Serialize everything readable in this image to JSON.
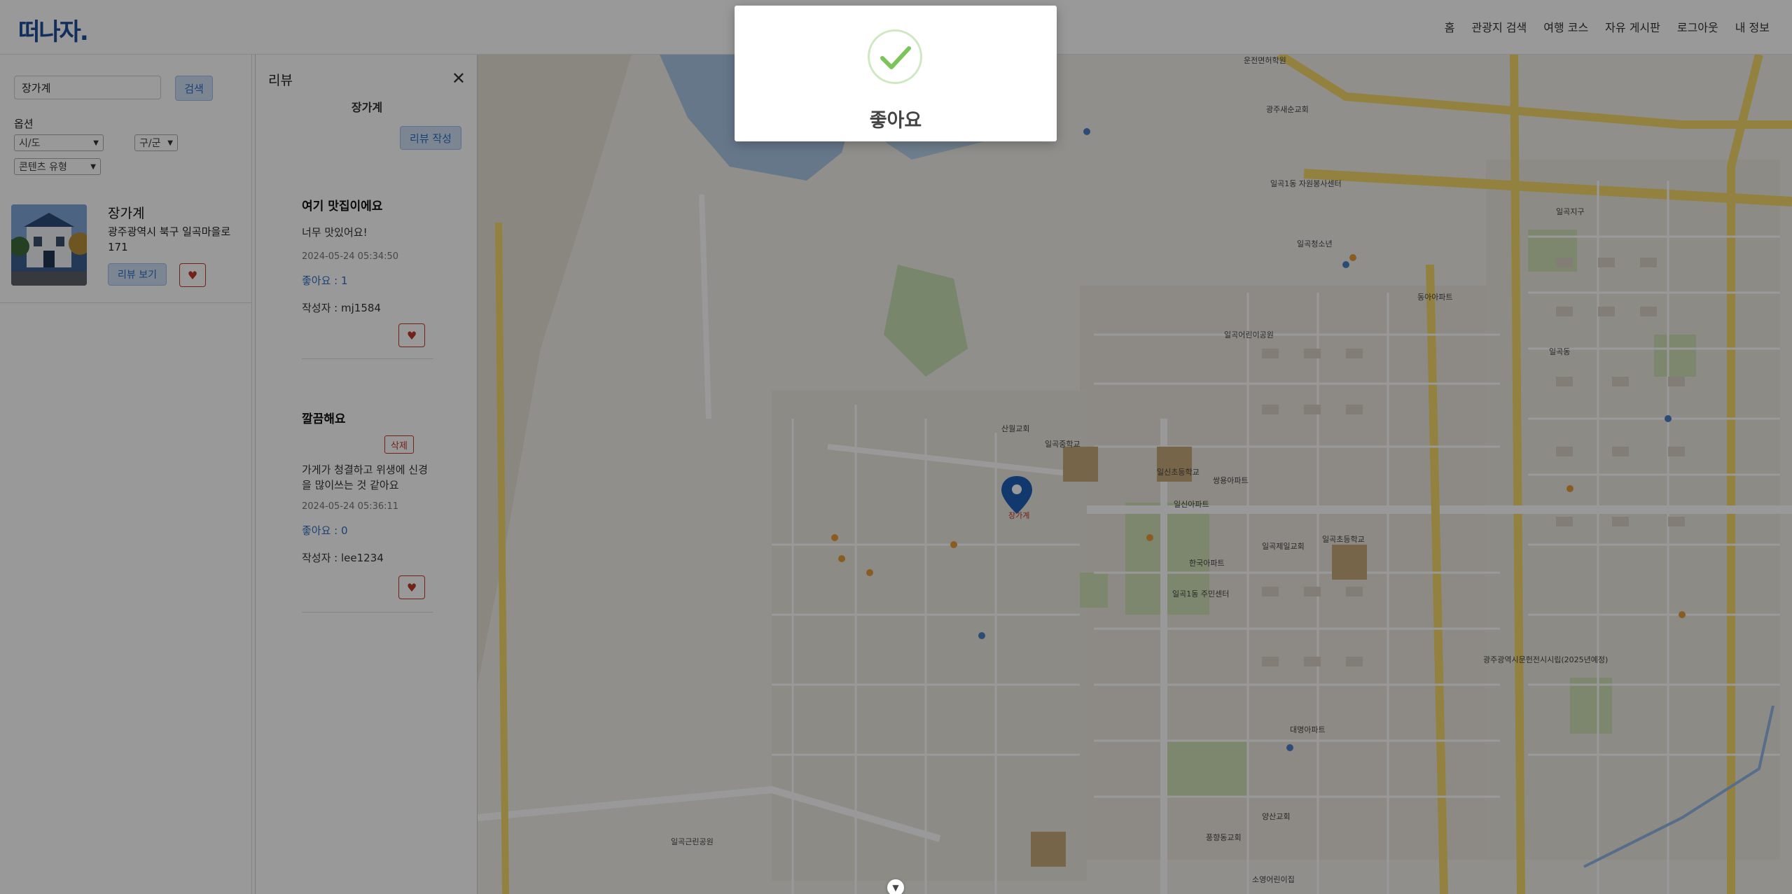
{
  "header": {
    "logo": "떠나자.",
    "nav": [
      "홈",
      "관광지 검색",
      "여행 코스",
      "자유 게시판",
      "로그아웃",
      "내 정보"
    ]
  },
  "search": {
    "value": "장가계",
    "button_label": "검색",
    "options_label": "옵션",
    "select_sido": "시/도",
    "select_gugun": "구/군",
    "select_content_type": "콘텐츠 유형"
  },
  "result": {
    "title": "장가계",
    "address": "광주광역시 북구 일곡마을로 171",
    "review_button": "리뷰 보기",
    "heart": "♥"
  },
  "review_panel": {
    "title": "리뷰",
    "store_name": "장가계",
    "write_button": "리뷰 작성",
    "reviews": [
      {
        "title": "여기 맛집이에요",
        "body": "너무 맛있어요!",
        "date": "2024-05-24 05:34:50",
        "likes": "좋아요 : 1",
        "author": "작성자 : mj1584",
        "heart": "♥"
      },
      {
        "title": "깔끔해요",
        "delete_button": "삭제",
        "body": "가게가 청결하고 위생에 신경을 많이쓰는 것 같아요",
        "date": "2024-05-24 05:36:11",
        "likes": "좋아요 : 0",
        "author": "작성자 : lee1234",
        "heart": "♥"
      }
    ]
  },
  "modal": {
    "message": "좋아요"
  },
  "map_labels": {
    "store_marker": "장가계",
    "labels": [
      "운전면허학원",
      "광주새순교회",
      "일곡1동 자원봉사센터",
      "일곡청소년",
      "일곡동",
      "일곡중학교",
      "일신초등학교",
      "산월교회",
      "일곡어린이공원",
      "대명아파트",
      "양산교회",
      "일곡근린공원",
      "소영어린이집",
      "한국아파트",
      "일곡1동 주민센터",
      "일곡초등학교",
      "동아아파트",
      "광주광역시문헌전시시립(2025년예정)",
      "일곡지구",
      "일곡제일교회",
      "풍향동교회",
      "일신아파트",
      "쌍용아파트"
    ]
  },
  "colors": {
    "brand": "#1d4e9a",
    "accent": "#2d6fc2",
    "danger": "#c0392b",
    "success_check": "#7cc45a"
  },
  "icons": {
    "close": "close-icon",
    "heart": "heart-icon",
    "check": "check-icon",
    "marker": "map-marker-icon"
  }
}
